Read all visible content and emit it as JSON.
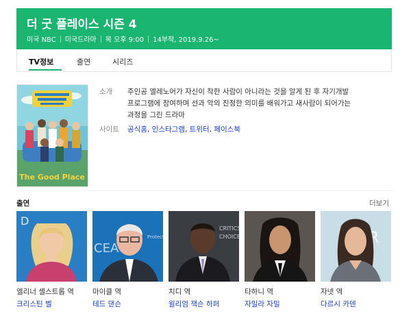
{
  "header": {
    "title": "더 굿 플레이스 시즌 4",
    "meta": [
      "미국 NBC",
      "미국드라마",
      "목 오후 9:00",
      "14부작, 2019.9.26~"
    ],
    "background": "#19b571"
  },
  "tabs": [
    {
      "label": "TV정보",
      "active": true
    },
    {
      "label": "출연",
      "active": false
    },
    {
      "label": "시리즈",
      "active": false
    }
  ],
  "poster": {
    "title_text": "The Good Place"
  },
  "info": {
    "summary_label": "소개",
    "summary_line1": "주인공 엘레노어가 자신이 착한 사람이 아니라는 것을 알게 된 후 자기개발",
    "summary_line2": "프로그램에 참여하며 선과 악의 진정한 의미를 배워가고 새사람이 되어가는",
    "summary_line3": "과정을 그린 드라마",
    "sites_label": "사이트",
    "sites": [
      "공식홈",
      "인스타그램",
      "트위터",
      "페이스북"
    ]
  },
  "cast_section": {
    "title": "출연",
    "more": "더보기",
    "members": [
      {
        "role": "엘리너 셸스트롭 역",
        "actor": "크리스틴 벨"
      },
      {
        "role": "마이클 역",
        "actor": "테드 댄슨"
      },
      {
        "role": "치디 역",
        "actor": "윌리엄 잭슨 하퍼"
      },
      {
        "role": "타하니 역",
        "actor": "자밀라 자밀"
      },
      {
        "role": "자넷 역",
        "actor": "다르시 카덴"
      }
    ]
  },
  "colors": {
    "accent": "#19b571",
    "link": "#1a3ed0"
  }
}
